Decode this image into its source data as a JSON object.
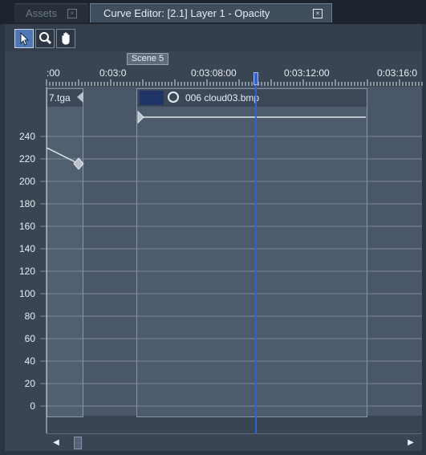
{
  "tabs": [
    {
      "label": "Assets",
      "active": false
    },
    {
      "label": "Curve Editor: [2.1] Layer 1 - Opacity",
      "active": true
    }
  ],
  "toolbar": {
    "tools": [
      {
        "name": "select",
        "icon": "arrow-cursor-icon",
        "active": true
      },
      {
        "name": "zoom",
        "icon": "magnifier-icon",
        "active": false
      },
      {
        "name": "pan",
        "icon": "hand-icon",
        "active": false
      }
    ]
  },
  "timeline": {
    "scene_marker": "Scene 5",
    "ticks": [
      ":00",
      "0:03:0",
      "0:03:08:00",
      "0:03:12:00",
      "0:03:16:0"
    ],
    "playhead_color": "#2f62d6"
  },
  "clips": {
    "left_label": "7.tga",
    "main_label": "006 cloud03.bmp"
  },
  "y_axis": {
    "labels": [
      "240",
      "220",
      "200",
      "180",
      "160",
      "140",
      "120",
      "100",
      "80",
      "60",
      "40",
      "20",
      "0"
    ]
  },
  "colors": {
    "background": "#2b3441",
    "panel": "#4a5768",
    "accent": "#2f62d6"
  }
}
